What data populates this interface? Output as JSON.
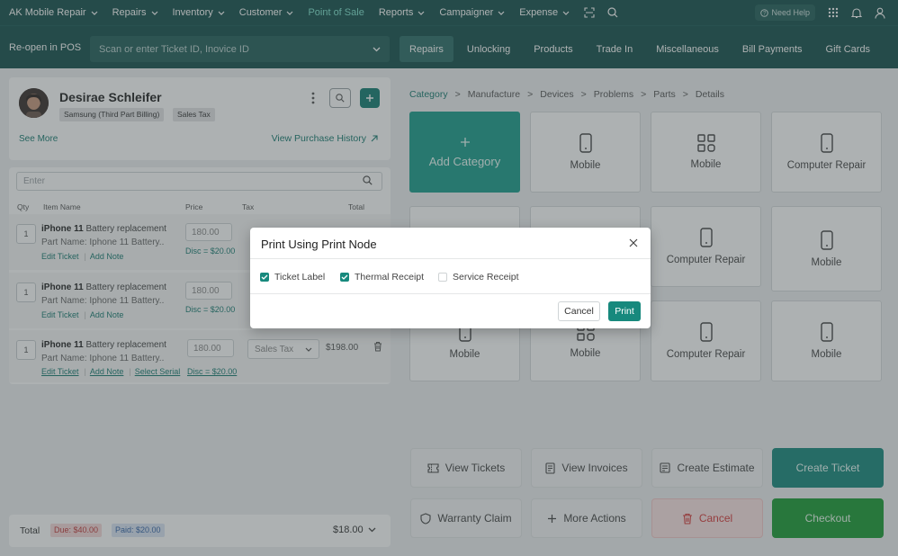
{
  "nav": {
    "items": [
      "AK Mobile Repair",
      "Repairs",
      "Inventory",
      "Customer",
      "Point of Sale",
      "Reports",
      "Campaigner",
      "Expense"
    ],
    "help": "Need Help"
  },
  "subbar": {
    "reopen": "Re-open in POS",
    "scan_placeholder": "Scan or enter Ticket ID, Inovice ID",
    "tabs": [
      "Repairs",
      "Unlocking",
      "Products",
      "Trade In",
      "Miscellaneous",
      "Bill Payments",
      "Gift Cards"
    ]
  },
  "customer": {
    "name": "Desirae Schleifer",
    "tags": [
      "Samsung (Third Part Billing)",
      "Sales Tax"
    ],
    "see_more": "See More",
    "view_history": "View Purchase History"
  },
  "items": {
    "search_placeholder": "Enter",
    "headers": [
      "Qty",
      "Item Name",
      "Price",
      "Tax",
      "Total"
    ],
    "rows": [
      {
        "qty": "1",
        "name": "iPhone 11",
        "desc": "Battery replacement",
        "part": "Part Name: Iphone 11 Battery..",
        "price": "180.00",
        "disc": "Disc = $20.00",
        "links": [
          "Edit Ticket",
          "Add Note"
        ]
      },
      {
        "qty": "1",
        "name": "iPhone 11",
        "desc": "Battery replacement",
        "part": "Part Name: Iphone 11 Battery..",
        "price": "180.00",
        "disc": "Disc = $20.00",
        "links": [
          "Edit Ticket",
          "Add Note"
        ]
      },
      {
        "qty": "1",
        "name": "iPhone 11",
        "desc": "Battery replacement",
        "part": "Part Name: Iphone 11 Battery..",
        "price": "180.00",
        "disc": "Disc = $20.00",
        "tax": "Sales Tax",
        "total": "$198.00",
        "links": [
          "Edit Ticket",
          "Add Note",
          "Select Serial"
        ]
      }
    ]
  },
  "footer": {
    "total_label": "Total",
    "due": "Due: $40.00",
    "paid": "Paid: $20.00",
    "amount": "$18.00"
  },
  "breadcrumb": [
    "Category",
    "Manufacture",
    "Devices",
    "Problems",
    "Parts",
    "Details"
  ],
  "tiles": [
    {
      "label": "Add Category",
      "icon": "plus-icon"
    },
    {
      "label": "Mobile",
      "icon": "phone-icon"
    },
    {
      "label": "Mobile",
      "icon": "grid-icon"
    },
    {
      "label": "Computer Repair",
      "icon": "phone-icon"
    },
    {
      "label": "",
      "icon": "phone-icon"
    },
    {
      "label": "",
      "icon": "grid-icon"
    },
    {
      "label": "Computer Repair",
      "icon": "phone-icon"
    },
    {
      "label": "Mobile",
      "icon": "phone-icon"
    },
    {
      "label": "Mobile",
      "icon": "phone-icon"
    },
    {
      "label": "Mobile",
      "icon": "grid-icon"
    },
    {
      "label": "Computer Repair",
      "icon": "phone-icon"
    },
    {
      "label": "Mobile",
      "icon": "phone-icon"
    }
  ],
  "actions": {
    "view_tickets": "View Tickets",
    "view_invoices": "View Invoices",
    "create_estimate": "Create Estimate",
    "create_ticket": "Create Ticket",
    "warranty_claim": "Warranty Claim",
    "more_actions": "More Actions",
    "cancel": "Cancel",
    "checkout": "Checkout"
  },
  "modal": {
    "title": "Print Using Print Node",
    "options": [
      {
        "label": "Ticket Label",
        "checked": true
      },
      {
        "label": "Thermal Receipt",
        "checked": true
      },
      {
        "label": "Service Receipt",
        "checked": false
      }
    ],
    "cancel": "Cancel",
    "print": "Print"
  },
  "colors": {
    "brand": "#16504c",
    "accent": "#17897d",
    "checkout": "#1a9b34",
    "danger": "#e33b3b"
  }
}
